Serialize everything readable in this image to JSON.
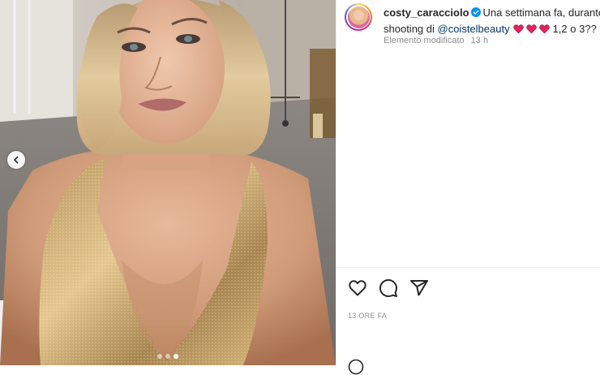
{
  "post": {
    "username": "costy_caracciolo",
    "caption_line1": "Una settimana fa, durante",
    "caption_line2_prefix": "shooting di ",
    "mention": "@coistelbeauty",
    "caption_suffix": "1,2 o 3??",
    "edited_label": "Elemento modificato",
    "time_ago": "13 h",
    "timestamp": "13 ORE FA"
  },
  "icons": {
    "verified": "verified-badge-icon",
    "heart": "heart-icon",
    "comment": "comment-icon",
    "share": "share-icon",
    "prev": "chevron-left-icon",
    "emoji": "emoji-icon"
  },
  "colors": {
    "mention": "#00376b",
    "verified": "#0095f6",
    "heart_emoji": "#e0245e"
  },
  "carousel": {
    "slides": 3,
    "active_index": 2
  }
}
